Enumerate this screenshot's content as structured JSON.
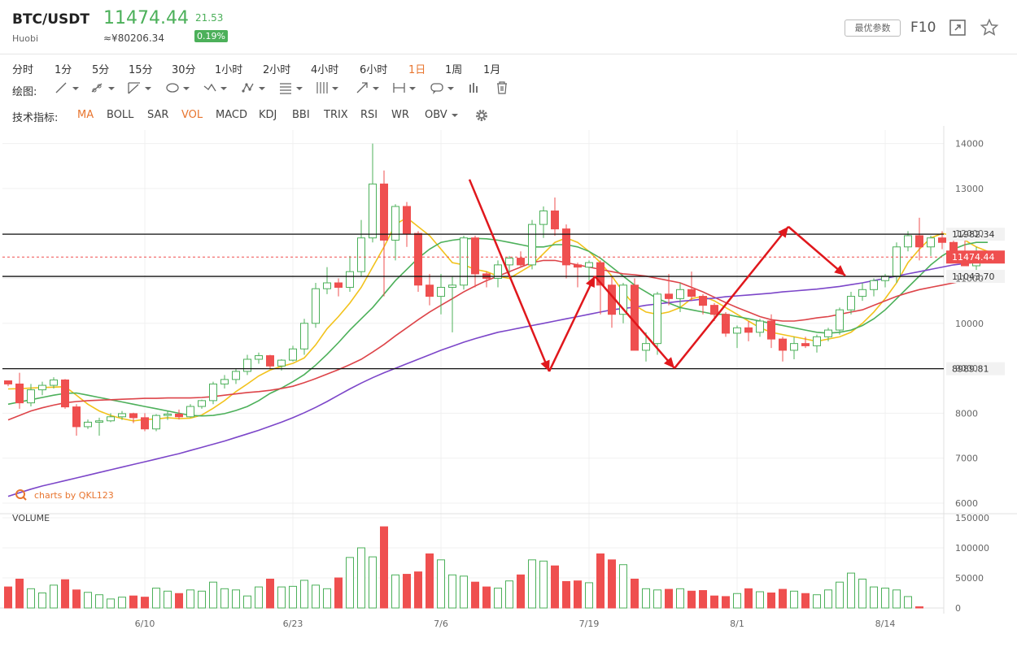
{
  "header": {
    "symbol": "BTC/USDT",
    "exchange": "Huobi",
    "price": "11474.44",
    "price_cny": "≈¥80206.34",
    "change": "21.53",
    "change_pct": "0.19%",
    "params_label": "最优参数",
    "f10_label": "F10",
    "colors": {
      "up": "#4cb05a",
      "accent": "#e8752f"
    }
  },
  "periods": {
    "items": [
      "分时",
      "1分",
      "5分",
      "15分",
      "30分",
      "1小时",
      "2小时",
      "4小时",
      "6小时",
      "1日",
      "1周",
      "1月"
    ],
    "active": "1日"
  },
  "tools": {
    "label": "绘图:",
    "icons": [
      "line-tool-icon",
      "ray-tool-icon",
      "channel-tool-icon",
      "ellipse-tool-icon",
      "wave-tool-icon",
      "pattern-tool-icon",
      "fibonacci-tool-icon",
      "parallel-lines-tool-icon",
      "arrow-tool-icon",
      "measure-tool-icon",
      "annotation-tool-icon",
      "price-range-tool-icon",
      "trash-icon"
    ]
  },
  "indicators": {
    "label": "技术指标:",
    "items": [
      "MA",
      "BOLL",
      "SAR",
      "VOL",
      "MACD",
      "KDJ",
      "BBI",
      "TRIX",
      "RSI",
      "WR",
      "OBV"
    ],
    "active": [
      "MA",
      "VOL"
    ]
  },
  "chart_data": {
    "type": "candlestick",
    "watermark": "charts by QKL123",
    "volume_label": "VOLUME",
    "price_axis": {
      "ticks": [
        6000,
        7000,
        8000,
        9000,
        10000,
        11000,
        12000,
        13000,
        14000
      ],
      "ylim": [
        5800,
        14300
      ]
    },
    "volume_axis": {
      "ticks": [
        0,
        50000,
        100000,
        150000
      ],
      "ylim": [
        0,
        150000
      ]
    },
    "x_ticks": [
      {
        "label": "6/10",
        "index": 12
      },
      {
        "label": "6/23",
        "index": 25
      },
      {
        "label": "7/6",
        "index": 38
      },
      {
        "label": "7/19",
        "index": 51
      },
      {
        "label": "8/1",
        "index": 64
      },
      {
        "label": "8/14",
        "index": 77
      }
    ],
    "candles": [
      [
        8720,
        8730,
        8600,
        8650
      ],
      [
        8650,
        8900,
        8100,
        8230
      ],
      [
        8230,
        8650,
        8150,
        8520
      ],
      [
        8520,
        8700,
        8400,
        8620
      ],
      [
        8620,
        8800,
        8550,
        8740
      ],
      [
        8740,
        8760,
        8100,
        8140
      ],
      [
        8140,
        8200,
        7500,
        7700
      ],
      [
        7700,
        7860,
        7650,
        7800
      ],
      [
        7800,
        7900,
        7500,
        7830
      ],
      [
        7830,
        8000,
        7800,
        7920
      ],
      [
        7920,
        8050,
        7850,
        7990
      ],
      [
        7990,
        8010,
        7780,
        7900
      ],
      [
        7900,
        8000,
        7600,
        7650
      ],
      [
        7650,
        7980,
        7600,
        7950
      ],
      [
        7950,
        8050,
        7850,
        7980
      ],
      [
        7980,
        8080,
        7860,
        7920
      ],
      [
        7920,
        8200,
        7900,
        8150
      ],
      [
        8150,
        8300,
        8100,
        8280
      ],
      [
        8280,
        8700,
        8200,
        8650
      ],
      [
        8650,
        8850,
        8550,
        8750
      ],
      [
        8750,
        9000,
        8650,
        8930
      ],
      [
        8930,
        9300,
        8850,
        9200
      ],
      [
        9200,
        9350,
        9100,
        9280
      ],
      [
        9280,
        9300,
        9000,
        9050
      ],
      [
        9050,
        9200,
        8950,
        9180
      ],
      [
        9180,
        9500,
        9150,
        9430
      ],
      [
        9430,
        10100,
        9300,
        10000
      ],
      [
        10000,
        10900,
        9900,
        10770
      ],
      [
        10770,
        11250,
        10650,
        10900
      ],
      [
        10900,
        11000,
        10600,
        10800
      ],
      [
        10800,
        11500,
        10700,
        11150
      ],
      [
        11150,
        12300,
        11050,
        11900
      ],
      [
        11900,
        14000,
        11800,
        13100
      ],
      [
        13100,
        13400,
        10600,
        11850
      ],
      [
        11850,
        12650,
        11400,
        12600
      ],
      [
        12600,
        12700,
        11700,
        12000
      ],
      [
        12000,
        12050,
        10700,
        10850
      ],
      [
        10850,
        11100,
        10400,
        10600
      ],
      [
        10600,
        11100,
        10200,
        10800
      ],
      [
        10800,
        11050,
        9800,
        10850
      ],
      [
        10850,
        11950,
        10750,
        11900
      ],
      [
        11900,
        11950,
        10800,
        11100
      ],
      [
        11100,
        11150,
        10800,
        11000
      ],
      [
        11000,
        11400,
        10800,
        11300
      ],
      [
        11300,
        11500,
        11100,
        11450
      ],
      [
        11450,
        11600,
        11250,
        11300
      ],
      [
        11300,
        12300,
        11200,
        12200
      ],
      [
        12200,
        12600,
        11900,
        12500
      ],
      [
        12500,
        12800,
        11950,
        12100
      ],
      [
        12100,
        12200,
        11000,
        11300
      ],
      [
        11300,
        11350,
        10800,
        11250
      ],
      [
        11250,
        11400,
        10950,
        11350
      ],
      [
        11350,
        11400,
        10200,
        10850
      ],
      [
        10850,
        11050,
        9900,
        10200
      ],
      [
        10200,
        10900,
        10000,
        10850
      ],
      [
        10850,
        11000,
        9800,
        9400
      ],
      [
        9400,
        9800,
        9150,
        9550
      ],
      [
        9550,
        10700,
        9300,
        10650
      ],
      [
        10650,
        11100,
        10400,
        10550
      ],
      [
        10550,
        10900,
        10250,
        10750
      ],
      [
        10750,
        11150,
        10500,
        10600
      ],
      [
        10600,
        10650,
        10200,
        10400
      ],
      [
        10400,
        10450,
        10050,
        10200
      ],
      [
        10200,
        10250,
        9700,
        9780
      ],
      [
        9780,
        9950,
        9450,
        9900
      ],
      [
        9900,
        10050,
        9600,
        9800
      ],
      [
        9800,
        10100,
        9700,
        10050
      ],
      [
        10050,
        10200,
        9450,
        9650
      ],
      [
        9650,
        9700,
        9150,
        9400
      ],
      [
        9400,
        9700,
        9200,
        9550
      ],
      [
        9550,
        9700,
        9450,
        9500
      ],
      [
        9500,
        9750,
        9350,
        9700
      ],
      [
        9700,
        9900,
        9600,
        9850
      ],
      [
        9850,
        10350,
        9750,
        10300
      ],
      [
        10300,
        10700,
        10200,
        10600
      ],
      [
        10600,
        10900,
        10500,
        10750
      ],
      [
        10750,
        11000,
        10600,
        10950
      ],
      [
        10950,
        11100,
        10800,
        11050
      ],
      [
        11050,
        11800,
        10900,
        11700
      ],
      [
        11700,
        12050,
        11600,
        11950
      ],
      [
        11950,
        12350,
        11400,
        11700
      ],
      [
        11700,
        11950,
        11500,
        11900
      ],
      [
        11900,
        12050,
        11650,
        11800
      ],
      [
        11800,
        11950,
        11350,
        11550
      ],
      [
        11550,
        11900,
        11300,
        11280
      ],
      [
        11280,
        11700,
        11100,
        11450
      ],
      [
        11450,
        11600,
        11350,
        11474
      ]
    ],
    "volumes": [
      35000,
      48000,
      32000,
      25000,
      38000,
      47000,
      30000,
      26000,
      22000,
      15000,
      18000,
      20000,
      18000,
      33000,
      28000,
      24000,
      30000,
      28000,
      43000,
      32000,
      30000,
      20000,
      35000,
      48000,
      35000,
      36000,
      46000,
      38000,
      32000,
      50000,
      84000,
      100000,
      85000,
      135000,
      55000,
      56000,
      60000,
      90000,
      80000,
      55000,
      53000,
      43000,
      35000,
      33000,
      45000,
      55000,
      80000,
      78000,
      70000,
      44000,
      45000,
      42000,
      90000,
      80000,
      72000,
      48000,
      32000,
      30000,
      31000,
      32000,
      28000,
      29000,
      20000,
      19000,
      24000,
      32000,
      27000,
      25000,
      31000,
      28000,
      24000,
      22000,
      30000,
      43000,
      58000,
      48000,
      35000,
      33000,
      30000,
      19000,
      2000
    ],
    "ma_series": [
      {
        "name": "MA5",
        "color": "#f2c21b",
        "values": [
          8540,
          8545,
          8560,
          8570,
          8580,
          8590,
          8400,
          8200,
          8050,
          7950,
          7880,
          7830,
          7860,
          7870,
          7900,
          7880,
          7890,
          7960,
          8110,
          8280,
          8480,
          8650,
          8830,
          8960,
          9040,
          9110,
          9230,
          9520,
          9880,
          10150,
          10450,
          10800,
          11250,
          11700,
          12200,
          12350,
          12150,
          11950,
          11650,
          11350,
          11300,
          11200,
          11150,
          11050,
          11000,
          11150,
          11300,
          11550,
          11800,
          11900,
          11800,
          11600,
          11350,
          11050,
          10700,
          10400,
          10250,
          10200,
          10250,
          10350,
          10550,
          10600,
          10500,
          10350,
          10200,
          10050,
          9900,
          9800,
          9750,
          9700,
          9650,
          9600,
          9650,
          9700,
          9800,
          10000,
          10250,
          10550,
          10900,
          11350,
          11650,
          11900,
          12000,
          11950,
          11850,
          11700,
          11600
        ]
      },
      {
        "name": "MA10",
        "color": "#4cb05a",
        "values": [
          8200,
          8250,
          8300,
          8350,
          8400,
          8440,
          8450,
          8400,
          8350,
          8300,
          8250,
          8200,
          8150,
          8100,
          8050,
          8000,
          7950,
          7940,
          7950,
          7990,
          8060,
          8150,
          8280,
          8440,
          8560,
          8700,
          8860,
          9070,
          9310,
          9570,
          9850,
          10100,
          10350,
          10650,
          10950,
          11200,
          11450,
          11650,
          11800,
          11850,
          11880,
          11890,
          11880,
          11850,
          11800,
          11750,
          11700,
          11700,
          11750,
          11750,
          11700,
          11600,
          11450,
          11250,
          11050,
          10850,
          10700,
          10550,
          10450,
          10350,
          10300,
          10250,
          10200,
          10200,
          10150,
          10100,
          10050,
          10000,
          9950,
          9900,
          9850,
          9800,
          9780,
          9800,
          9850,
          9950,
          10100,
          10300,
          10550,
          10800,
          11050,
          11300,
          11500,
          11650,
          11750,
          11800,
          11800
        ]
      },
      {
        "name": "MA30",
        "color": "#dd4449",
        "values": [
          7850,
          7950,
          8050,
          8120,
          8180,
          8230,
          8260,
          8280,
          8290,
          8300,
          8310,
          8320,
          8330,
          8330,
          8340,
          8340,
          8340,
          8350,
          8370,
          8400,
          8430,
          8460,
          8480,
          8510,
          8550,
          8600,
          8680,
          8770,
          8870,
          8970,
          9080,
          9200,
          9360,
          9530,
          9720,
          9900,
          10080,
          10250,
          10400,
          10550,
          10700,
          10830,
          10950,
          11050,
          11150,
          11250,
          11350,
          11400,
          11400,
          11350,
          11300,
          11250,
          11200,
          11150,
          11100,
          11080,
          11050,
          11000,
          10950,
          10900,
          10800,
          10700,
          10580,
          10460,
          10350,
          10250,
          10150,
          10080,
          10050,
          10050,
          10080,
          10120,
          10150,
          10200,
          10250,
          10300,
          10400,
          10500,
          10600,
          10680,
          10750,
          10800,
          10850,
          10900,
          10950,
          11000,
          11050
        ]
      },
      {
        "name": "MA120",
        "color": "#7c46c9",
        "values": [
          6150,
          6230,
          6310,
          6380,
          6440,
          6500,
          6560,
          6620,
          6680,
          6740,
          6800,
          6860,
          6920,
          6980,
          7040,
          7100,
          7170,
          7240,
          7310,
          7380,
          7460,
          7540,
          7620,
          7710,
          7800,
          7900,
          8010,
          8130,
          8260,
          8400,
          8540,
          8670,
          8790,
          8900,
          9000,
          9100,
          9200,
          9300,
          9400,
          9490,
          9580,
          9660,
          9730,
          9800,
          9850,
          9900,
          9950,
          10000,
          10050,
          10100,
          10150,
          10200,
          10250,
          10300,
          10330,
          10360,
          10400,
          10430,
          10460,
          10490,
          10510,
          10540,
          10560,
          10590,
          10610,
          10630,
          10650,
          10670,
          10700,
          10720,
          10740,
          10760,
          10790,
          10820,
          10860,
          10900,
          10950,
          11000,
          11050,
          11100,
          11150,
          11200,
          11250,
          11300,
          11330,
          11360,
          11390
        ]
      }
    ],
    "levels": [
      11982.34,
      11474.44,
      11043.7,
      8989.81
    ],
    "level_labels": [
      "11982.34",
      "11474.44",
      "11043.70",
      "8989.81"
    ],
    "arrows": [
      {
        "from": [
          40.5,
          13200
        ],
        "to": [
          47.5,
          8930
        ]
      },
      {
        "from": [
          47.5,
          8930
        ],
        "to": [
          51.5,
          11050
        ]
      },
      {
        "from": [
          51.5,
          11050
        ],
        "to": [
          58.5,
          9000
        ]
      },
      {
        "from": [
          58.5,
          9000
        ],
        "to": [
          68.5,
          12150
        ]
      },
      {
        "from": [
          68.5,
          12150
        ],
        "to": [
          73.5,
          11060
        ]
      }
    ]
  }
}
